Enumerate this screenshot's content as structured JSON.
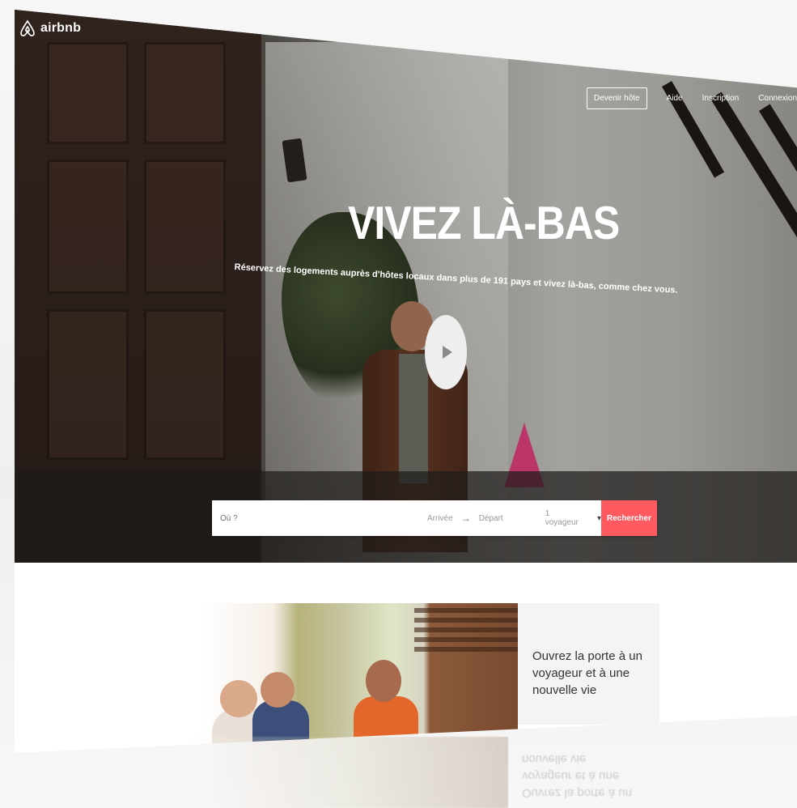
{
  "brand": {
    "name": "airbnb"
  },
  "nav": {
    "host_button": "Devenir hôte",
    "help": "Aide",
    "signup": "Inscription",
    "login": "Connexion"
  },
  "hero": {
    "title": "VIVEZ LÀ-BAS",
    "subtitle": "Réservez des logements auprès d'hôtes locaux dans plus de 191 pays et vivez là-bas, comme chez vous."
  },
  "search": {
    "where_placeholder": "Où ?",
    "arrival": "Arrivée",
    "departure": "Départ",
    "guests": "1 voyageur",
    "submit": "Rechercher"
  },
  "promo": {
    "tagline": "Ouvrez la porte à un voyageur et à une nouvelle vie"
  },
  "colors": {
    "accent": "#ff5a5f",
    "text": "#333333"
  }
}
